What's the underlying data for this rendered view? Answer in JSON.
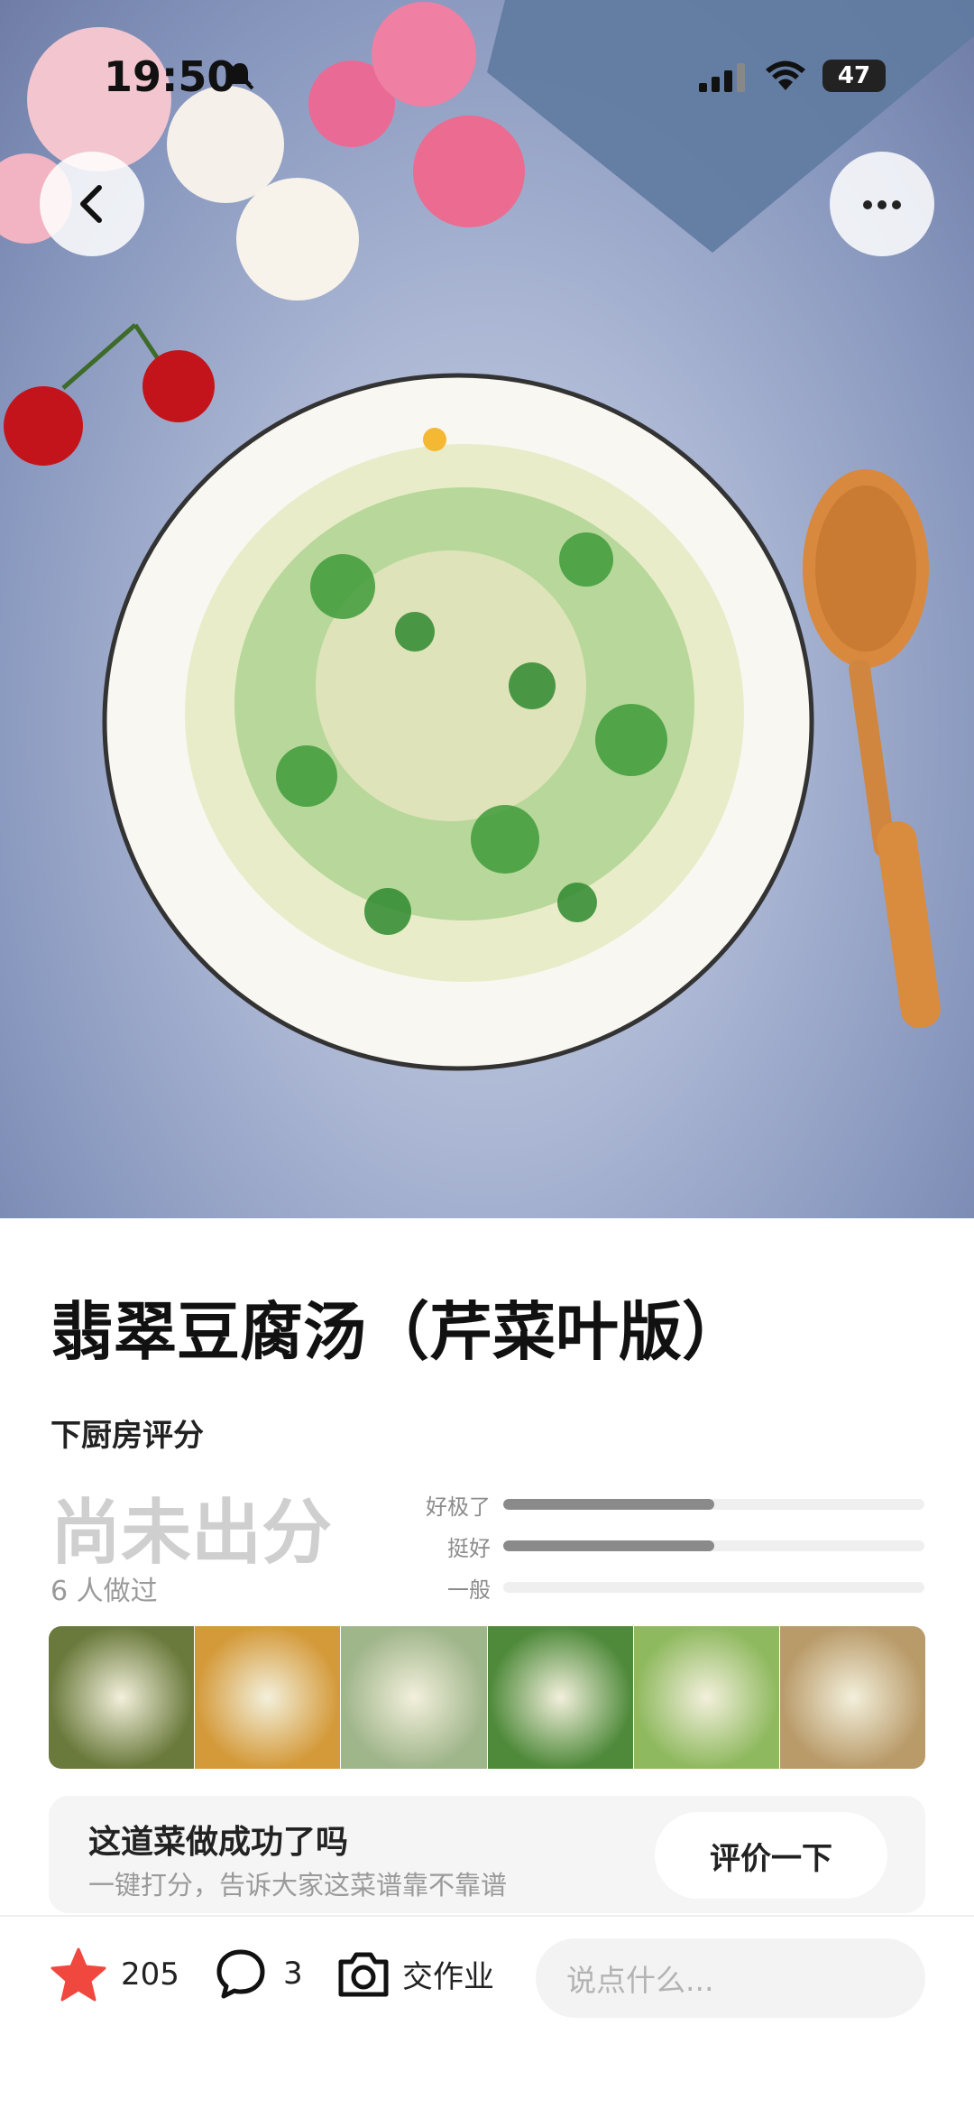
{
  "status_bar": {
    "time": "19:50",
    "battery": "47"
  },
  "recipe": {
    "title": "翡翠豆腐汤（芹菜叶版）"
  },
  "rating": {
    "section_title": "下厨房评分",
    "score_text": "尚未出分",
    "made_count": "6 人做过",
    "levels": [
      {
        "label": "好极了",
        "fraction": 0.5
      },
      {
        "label": "挺好",
        "fraction": 0.5
      },
      {
        "label": "一般",
        "fraction": 0.0
      }
    ]
  },
  "thumbnails": [
    {
      "name": "thumb-1",
      "color": "#6a7a3c"
    },
    {
      "name": "thumb-2",
      "color": "#d49a3a"
    },
    {
      "name": "thumb-3",
      "color": "#9fb58a"
    },
    {
      "name": "thumb-4",
      "color": "#4f8a3b"
    },
    {
      "name": "thumb-5",
      "color": "#8fb95f"
    },
    {
      "name": "thumb-6",
      "color": "#b99b6a"
    }
  ],
  "feedback_prompt": {
    "question": "这道菜做成功了吗",
    "subtitle": "一键打分，告诉大家这菜谱靠不靠谱",
    "button_label": "评价一下"
  },
  "bottom_bar": {
    "likes": "205",
    "comments": "3",
    "homework_label": "交作业",
    "input_placeholder": "说点什么..."
  },
  "colors": {
    "accent": "#f0483e"
  }
}
